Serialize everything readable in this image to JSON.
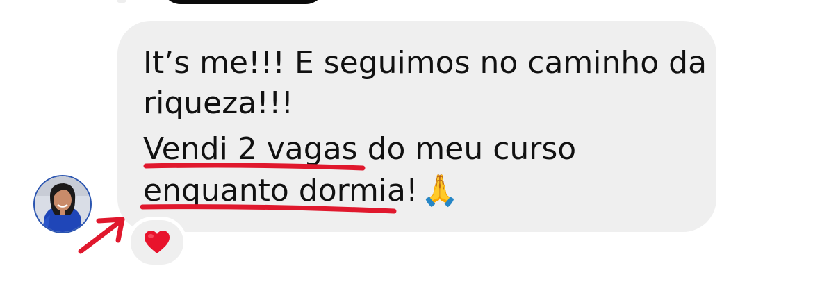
{
  "message": {
    "lines": [
      "It’s me!!! E seguimos no caminho da",
      "riqueza!!!",
      "Vendi 2 vagas do meu curso",
      "enquanto dormia!"
    ],
    "trailing_emoji": "🙏"
  },
  "reaction": {
    "emoji": "❤️",
    "icon": "red-heart-icon"
  },
  "avatar": {
    "icon": "profile-photo"
  },
  "annotations": {
    "color": "#e0182d",
    "underlines": [
      "Vendi 2 vagas",
      "enquanto dormia"
    ],
    "arrow_target": "heart-reaction"
  },
  "colors": {
    "bubble": "#efefef",
    "text": "#111111",
    "background": "#ffffff"
  }
}
